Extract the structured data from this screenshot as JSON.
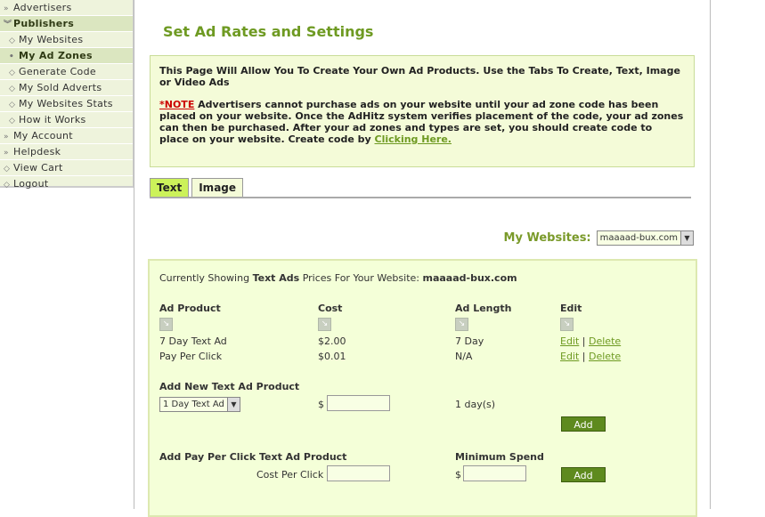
{
  "sidebar": [
    {
      "label": "Advertisers",
      "icon": "double-chevron-right-icon",
      "type": "head-collapsed"
    },
    {
      "label": "Publishers",
      "icon": "double-chevron-down-icon",
      "type": "head"
    },
    {
      "label": "My Websites",
      "icon": "diamond-icon",
      "type": "sub"
    },
    {
      "label": "My Ad Zones",
      "icon": "bullet-icon",
      "type": "active"
    },
    {
      "label": "Generate Code",
      "icon": "diamond-icon",
      "type": "sub"
    },
    {
      "label": "My Sold Adverts",
      "icon": "diamond-icon",
      "type": "sub"
    },
    {
      "label": "My Websites Stats",
      "icon": "diamond-icon",
      "type": "sub"
    },
    {
      "label": "How it Works",
      "icon": "diamond-icon",
      "type": "sub"
    },
    {
      "label": "My Account",
      "icon": "double-chevron-right-icon",
      "type": "top"
    },
    {
      "label": "Helpdesk",
      "icon": "double-chevron-right-icon",
      "type": "top"
    },
    {
      "label": "View Cart",
      "icon": "diamond-icon",
      "type": "top"
    },
    {
      "label": "Logout",
      "icon": "diamond-icon",
      "type": "top"
    }
  ],
  "title": "Set Ad Rates and Settings",
  "info": {
    "intro": "This Page Will Allow You To Create Your Own Ad Products. Use the Tabs To Create, Text, Image or Video Ads",
    "note_label": "*NOTE",
    "note": " Advertisers cannot purchase ads on your website until your ad zone code has been placed on your website. Once the AdHitz system verifies placement of the code, your ad zones can then be purchased. After your ad zones and types are set, you should create code to place on your website. Create code by ",
    "link": "Clicking Here."
  },
  "tabs": [
    "Text",
    "Image"
  ],
  "my_websites": {
    "label": "My Websites:",
    "value": "maaaad-bux.com"
  },
  "box": {
    "showing_pre": "Currently Showing ",
    "showing_type": "Text Ads",
    "showing_mid": " Prices For Your Website: ",
    "showing_site": "maaaad-bux.com",
    "headers": [
      "Ad Product",
      "Cost",
      "Ad Length",
      "Edit"
    ],
    "rows": [
      {
        "product": "7 Day Text Ad",
        "cost": "$2.00",
        "length": "7 Day",
        "edit": "Edit",
        "delete": "Delete"
      },
      {
        "product": "Pay Per Click",
        "cost": "$0.01",
        "length": "N/A",
        "edit": "Edit",
        "delete": "Delete"
      }
    ],
    "add_title": "Add New Text Ad Product",
    "add_select": "1 Day Text Ad",
    "dollar": "$",
    "days": "1 day(s)",
    "add_btn": "Add",
    "ppc_title": "Add Pay Per Click Text Ad Product",
    "ppc_label": "Cost Per Click $",
    "min_title": "Minimum Spend",
    "min_dollar": "$",
    "ppc_btn": "Add"
  }
}
